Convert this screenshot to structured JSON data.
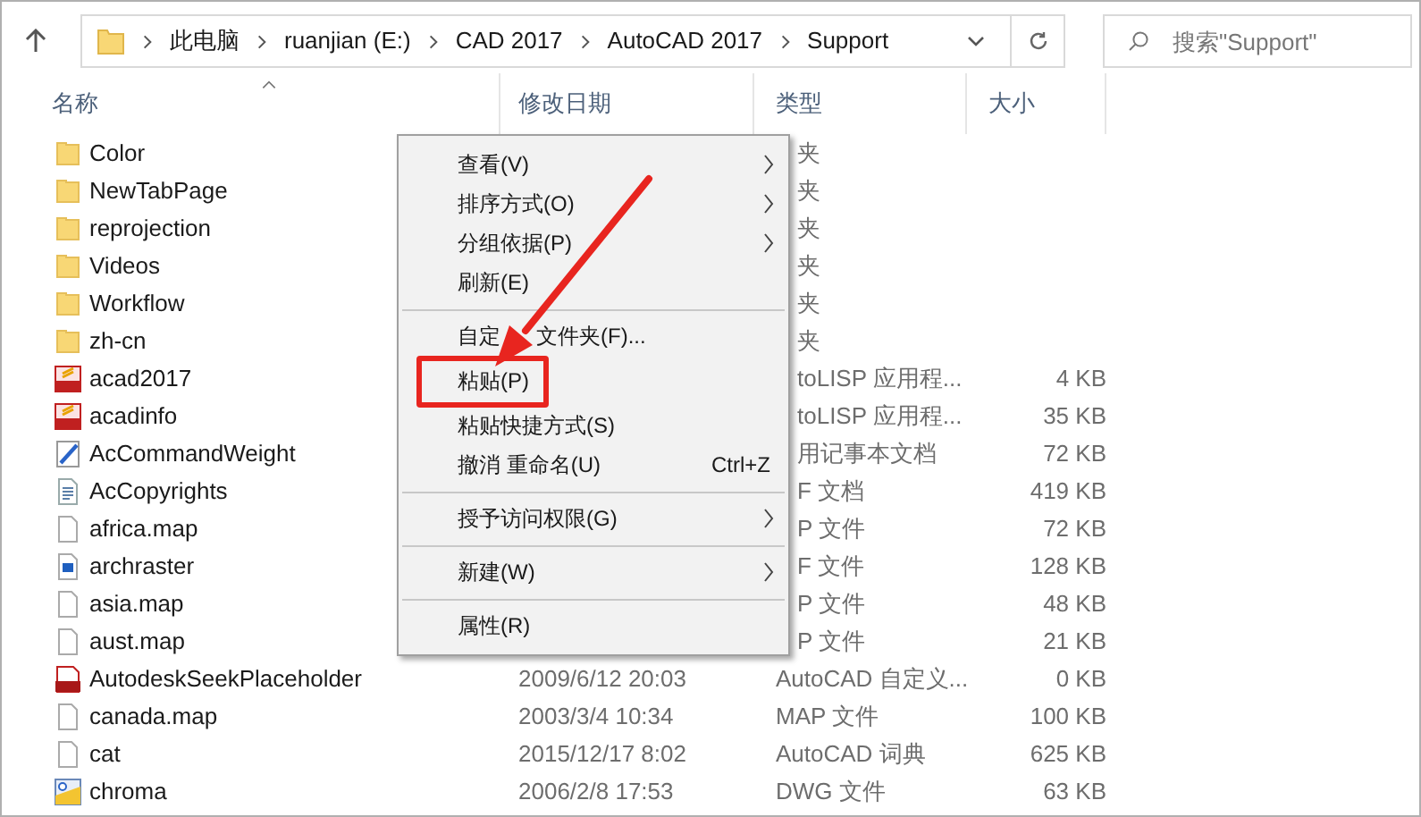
{
  "address_bar": {
    "path": [
      "此电脑",
      "ruanjian (E:)",
      "CAD 2017",
      "AutoCAD 2017",
      "Support"
    ]
  },
  "search": {
    "placeholder": "搜索\"Support\""
  },
  "columns": [
    {
      "label": "名称",
      "sorted": true
    },
    {
      "label": "修改日期",
      "sorted": false
    },
    {
      "label": "类型",
      "sorted": false
    },
    {
      "label": "大小",
      "sorted": false
    }
  ],
  "files": [
    {
      "name": "Color",
      "kind": "folder",
      "type": "夹"
    },
    {
      "name": "NewTabPage",
      "kind": "folder",
      "type": "夹"
    },
    {
      "name": "reprojection",
      "kind": "folder",
      "type": "夹"
    },
    {
      "name": "Videos",
      "kind": "folder",
      "type": "夹"
    },
    {
      "name": "Workflow",
      "kind": "folder",
      "type": "夹"
    },
    {
      "name": "zh-cn",
      "kind": "folder",
      "type": "夹"
    },
    {
      "name": "acad2017",
      "kind": "lsp",
      "type": "toLISP 应用程...",
      "size": "4 KB"
    },
    {
      "name": "acadinfo",
      "kind": "lsp",
      "type": "toLISP 应用程...",
      "size": "35 KB"
    },
    {
      "name": "AcCommandWeight",
      "kind": "edit",
      "type": "用记事本文档",
      "size": "72 KB"
    },
    {
      "name": "AcCopyrights",
      "kind": "text",
      "type": "F 文档",
      "size": "419 KB"
    },
    {
      "name": "africa.map",
      "kind": "file",
      "type": "P 文件",
      "size": "72 KB"
    },
    {
      "name": "archraster",
      "kind": "image",
      "type": "F 文件",
      "size": "128 KB"
    },
    {
      "name": "asia.map",
      "kind": "file",
      "type": "P 文件",
      "size": "48 KB"
    },
    {
      "name": "aust.map",
      "kind": "file",
      "type": "P 文件",
      "size": "21 KB"
    },
    {
      "name": "AutodeskSeekPlaceholder",
      "kind": "cux",
      "date": "2009/6/12 20:03",
      "type": "AutoCAD 自定义...",
      "size": "0 KB"
    },
    {
      "name": "canada.map",
      "kind": "file",
      "date": "2003/3/4 10:34",
      "type": "MAP 文件",
      "size": "100 KB"
    },
    {
      "name": "cat",
      "kind": "file",
      "date": "2015/12/17 8:02",
      "type": "AutoCAD 词典",
      "size": "625 KB"
    },
    {
      "name": "chroma",
      "kind": "dwg",
      "date": "2006/2/8 17:53",
      "type": "DWG 文件",
      "size": "63 KB"
    }
  ],
  "context_menu": {
    "items": [
      {
        "kind": "item",
        "label": "查看(V)",
        "submenu": true,
        "annotated": false
      },
      {
        "kind": "item",
        "label": "排序方式(O)",
        "submenu": true,
        "annotated": false
      },
      {
        "kind": "item",
        "label": "分组依据(P)",
        "submenu": true,
        "annotated": false
      },
      {
        "kind": "item",
        "label": "刷新(E)",
        "submenu": false,
        "annotated": false
      },
      {
        "kind": "separator"
      },
      {
        "kind": "item",
        "label_parts": [
          "自定",
          "文件夹(F)..."
        ],
        "submenu": false,
        "annotated": false
      },
      {
        "kind": "item",
        "label": "粘贴(P)",
        "submenu": false,
        "annotated": true
      },
      {
        "kind": "item",
        "label": "粘贴快捷方式(S)",
        "submenu": false,
        "annotated": false
      },
      {
        "kind": "item",
        "label": "撤消 重命名(U)",
        "shortcut": "Ctrl+Z",
        "submenu": false,
        "annotated": false
      },
      {
        "kind": "separator"
      },
      {
        "kind": "item",
        "label": "授予访问权限(G)",
        "submenu": true,
        "annotated": false
      },
      {
        "kind": "separator"
      },
      {
        "kind": "item",
        "label": "新建(W)",
        "submenu": true,
        "annotated": false
      },
      {
        "kind": "separator"
      },
      {
        "kind": "item",
        "label": "属性(R)",
        "submenu": false,
        "annotated": false
      }
    ]
  }
}
